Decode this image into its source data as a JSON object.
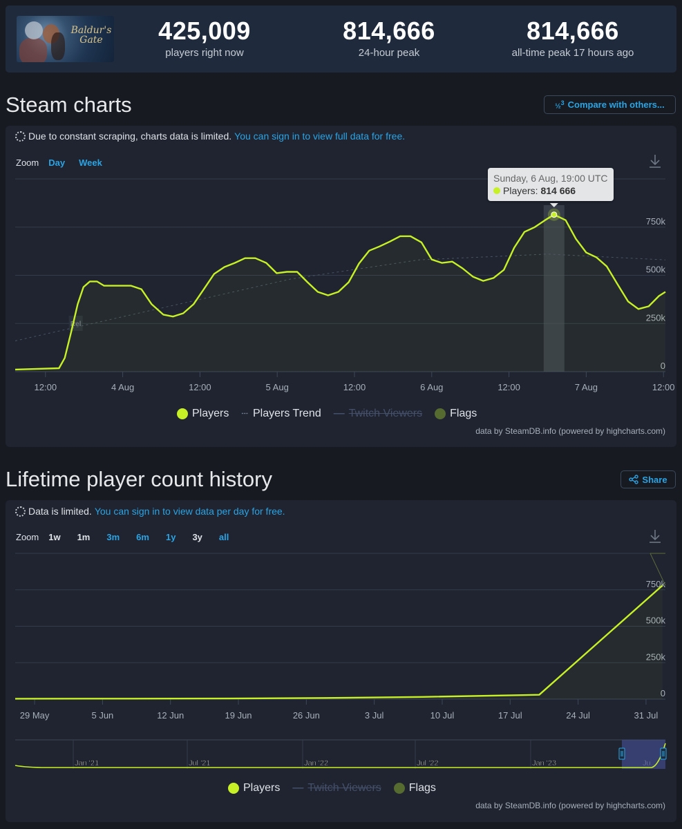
{
  "header": {
    "game_thumbnail_alt": "Baldur's Gate 3",
    "game_logo_text": "Baldur's Gate",
    "stats": [
      {
        "value": "425,009",
        "label": "players right now"
      },
      {
        "value": "814,666",
        "label": "24-hour peak"
      },
      {
        "value": "814,666",
        "label": "all-time peak 17 hours ago"
      }
    ]
  },
  "steam_charts": {
    "title": "Steam charts",
    "compare_button": "Compare with others...",
    "compare_icon": "1/2/3",
    "notice_text": "Due to constant scraping, charts data is limited.",
    "notice_link": "You can sign in to view full data for free.",
    "zoom_label": "Zoom",
    "zoom_options": [
      "Day",
      "Week"
    ],
    "tooltip": {
      "title": "Sunday, 6 Aug, 19:00 UTC",
      "series": "Players:",
      "value": "814 666"
    },
    "flag_label": "Rel",
    "legend": [
      {
        "label": "Players",
        "state": "visible",
        "color": "#c8f026"
      },
      {
        "label": "Players Trend",
        "state": "visible",
        "color": "#6b7686"
      },
      {
        "label": "Twitch Viewers",
        "state": "hidden",
        "color": "#44506a"
      },
      {
        "label": "Flags",
        "state": "visible",
        "color": "#556b2f"
      }
    ],
    "credit": "data by SteamDB.info (powered by highcharts.com)"
  },
  "lifetime": {
    "title": "Lifetime player count history",
    "share_button": "Share",
    "notice_text": "Data is limited.",
    "notice_link": "You can sign in to view data per day for free.",
    "zoom_label": "Zoom",
    "zoom_options": [
      {
        "label": "1w",
        "active": false
      },
      {
        "label": "1m",
        "active": false
      },
      {
        "label": "3m",
        "active": true
      },
      {
        "label": "6m",
        "active": true
      },
      {
        "label": "1y",
        "active": true
      },
      {
        "label": "3y",
        "active": false
      },
      {
        "label": "all",
        "active": true
      }
    ],
    "navigator_labels": [
      "Jan '21",
      "Jul '21",
      "Jan '22",
      "Jul '22",
      "Jan '23",
      "Ju..."
    ],
    "legend": [
      {
        "label": "Players",
        "state": "visible",
        "color": "#c8f026"
      },
      {
        "label": "Twitch Viewers",
        "state": "hidden",
        "color": "#44506a"
      },
      {
        "label": "Flags",
        "state": "visible",
        "color": "#556b2f"
      }
    ],
    "credit": "data by SteamDB.info (powered by highcharts.com)"
  },
  "chart_data": [
    {
      "type": "line",
      "title": "Steam charts",
      "xlabel": "",
      "ylabel": "Players",
      "ylim": [
        0,
        1000000
      ],
      "yticks": [
        0,
        250000,
        500000,
        750000
      ],
      "ytick_labels": [
        "0",
        "250k",
        "500k",
        "750k"
      ],
      "xtick_labels": [
        "12:00",
        "4 Aug",
        "12:00",
        "5 Aug",
        "12:00",
        "6 Aug",
        "12:00",
        "7 Aug",
        "12:00"
      ],
      "xtick_hours": [
        12,
        24,
        36,
        48,
        60,
        72,
        84,
        96,
        108
      ],
      "x_unit": "hours since 3 Aug 00:00 UTC",
      "xlim": [
        7.3,
        108.3
      ],
      "grid": true,
      "legend_position": "bottom-center",
      "highlight": {
        "x_hour": 91,
        "value": 814666,
        "label": "Sunday, 6 Aug, 19:00 UTC"
      },
      "series": [
        {
          "name": "Players",
          "x": [
            7.3,
            14.1,
            15.0,
            16.0,
            17.0,
            17.9,
            18.9,
            20.0,
            21.1,
            22.1,
            23.7,
            25.3,
            26.9,
            28.5,
            30.3,
            31.8,
            33.4,
            35.0,
            36.6,
            38.2,
            39.8,
            41.4,
            43.0,
            44.6,
            46.3,
            47.9,
            49.5,
            51.1,
            52.7,
            54.3,
            55.9,
            57.5,
            59.1,
            60.7,
            62.3,
            63.9,
            65.5,
            67.1,
            68.7,
            70.4,
            72.0,
            73.6,
            75.2,
            76.8,
            78.4,
            80.0,
            81.6,
            83.2,
            84.8,
            86.4,
            88.0,
            89.6,
            91.0,
            92.8,
            94.4,
            96.0,
            97.6,
            99.2,
            100.8,
            102.5,
            104.1,
            105.7,
            107.3,
            108.3
          ],
          "values": [
            11000,
            18000,
            71000,
            207000,
            350000,
            439000,
            468000,
            468000,
            446000,
            446000,
            446000,
            446000,
            428000,
            350000,
            296000,
            286000,
            303000,
            350000,
            428000,
            507000,
            543000,
            564000,
            589000,
            589000,
            564000,
            511000,
            518000,
            518000,
            464000,
            414000,
            396000,
            414000,
            464000,
            561000,
            628000,
            650000,
            675000,
            703000,
            703000,
            671000,
            582000,
            564000,
            571000,
            536000,
            493000,
            471000,
            486000,
            528000,
            643000,
            725000,
            750000,
            786000,
            814666,
            786000,
            689000,
            618000,
            593000,
            546000,
            457000,
            364000,
            325000,
            339000,
            393000,
            414000
          ]
        },
        {
          "name": "Players Trend",
          "x": [
            7.3,
            30,
            50,
            70,
            90,
            108.3
          ],
          "values": [
            160000,
            330000,
            480000,
            580000,
            610000,
            580000
          ]
        }
      ]
    },
    {
      "type": "line",
      "title": "Lifetime player count history",
      "xlabel": "",
      "ylabel": "Players",
      "ylim": [
        0,
        1000000
      ],
      "yticks": [
        0,
        250000,
        500000,
        750000
      ],
      "ytick_labels": [
        "0",
        "250k",
        "500k",
        "750k"
      ],
      "xtick_labels": [
        "29 May",
        "5 Jun",
        "12 Jun",
        "19 Jun",
        "26 Jun",
        "3 Jul",
        "10 Jul",
        "17 Jul",
        "24 Jul",
        "31 Jul"
      ],
      "x_unit": "days since 29 May 2023",
      "xtick_days": [
        0,
        7,
        14,
        21,
        28,
        35,
        42,
        49,
        56,
        63
      ],
      "xlim": [
        -2,
        65
      ],
      "grid": true,
      "legend_position": "bottom-center",
      "series": [
        {
          "name": "Players",
          "x": [
            -2,
            10,
            20,
            30,
            40,
            52,
            64.7
          ],
          "values": [
            3000,
            3500,
            4500,
            8000,
            15000,
            30000,
            780000
          ]
        }
      ],
      "navigator": {
        "range": [
          "2020-10",
          "2023-08"
        ],
        "selected_range": [
          "2023-05-27",
          "2023-08-07"
        ]
      }
    }
  ]
}
